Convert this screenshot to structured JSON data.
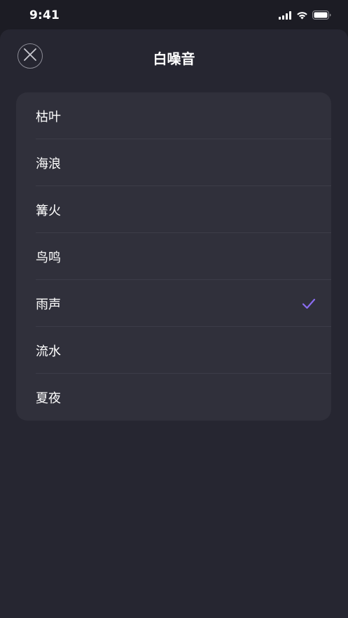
{
  "status_bar": {
    "time": "9:41",
    "icons": [
      "cellular-signal-icon",
      "wifi-icon",
      "battery-icon"
    ]
  },
  "sheet": {
    "title": "白噪音",
    "close_icon": "close-icon"
  },
  "sound_list": {
    "selected_index": 4,
    "accent_color": "#8a6cf0",
    "items": [
      {
        "label": "枯叶",
        "selected": false
      },
      {
        "label": "海浪",
        "selected": false
      },
      {
        "label": "篝火",
        "selected": false
      },
      {
        "label": "鸟鸣",
        "selected": false
      },
      {
        "label": "雨声",
        "selected": true
      },
      {
        "label": "流水",
        "selected": false
      },
      {
        "label": "夏夜",
        "selected": false
      }
    ]
  }
}
